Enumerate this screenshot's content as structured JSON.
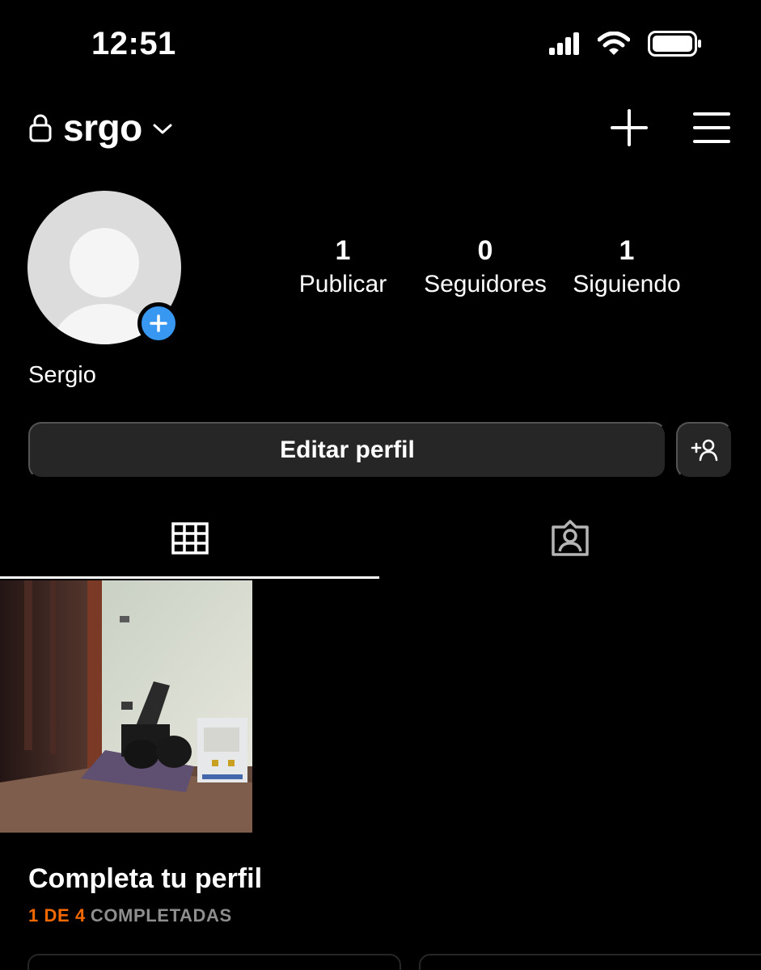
{
  "status_bar": {
    "time": "12:51",
    "icons": [
      "signal-icon",
      "wifi-icon",
      "battery-icon"
    ]
  },
  "header": {
    "username": "srgo",
    "icons": [
      "lock-icon",
      "chevron-down-icon",
      "plus-icon",
      "menu-icon"
    ]
  },
  "profile": {
    "display_name": "Sergio",
    "stats": [
      {
        "value": "1",
        "label": "Publicar"
      },
      {
        "value": "0",
        "label": "Seguidores"
      },
      {
        "value": "1",
        "label": "Siguiendo"
      }
    ]
  },
  "actions": {
    "edit_profile_label": "Editar perfil"
  },
  "tabs": [
    {
      "icon": "grid-icon",
      "selected": true
    },
    {
      "icon": "tagged-icon",
      "selected": false
    }
  ],
  "complete_profile": {
    "title": "Completa tu perfil",
    "progress_count": "1 DE 4",
    "progress_label": "COMPLETADAS"
  },
  "colors": {
    "background": "#000000",
    "button": "#262626",
    "accent_blue": "#3897f0",
    "accent_orange": "#f56a00",
    "muted": "#8e8e8e"
  }
}
